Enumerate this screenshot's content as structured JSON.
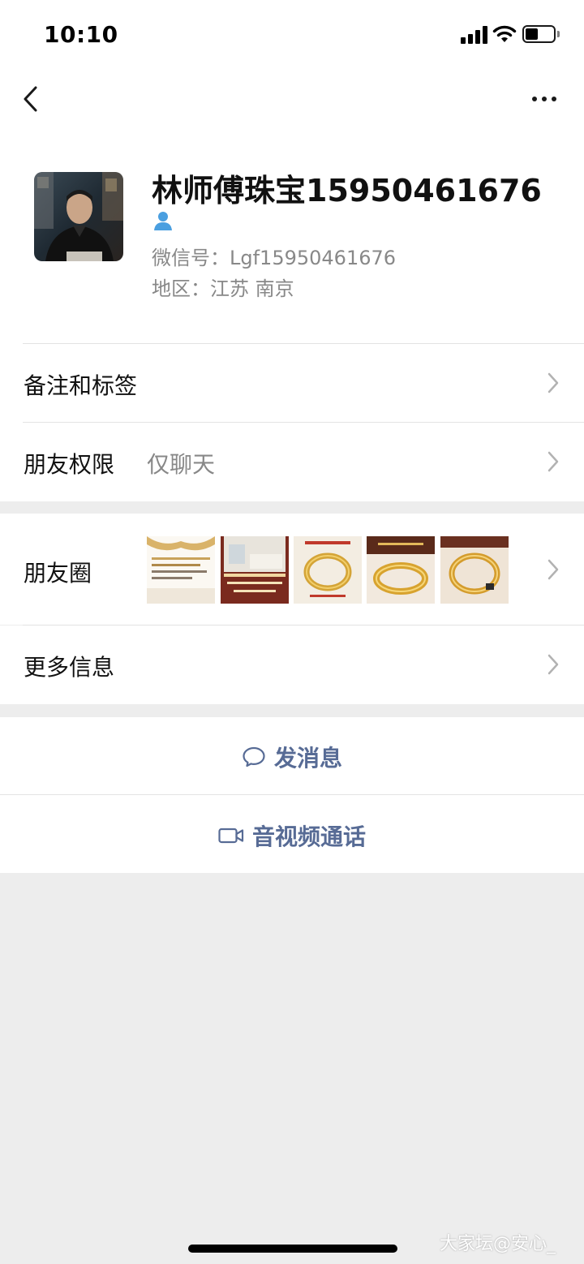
{
  "status_bar": {
    "time": "10:10"
  },
  "profile": {
    "name": "林师傅珠宝15950461676",
    "wechat_id": "微信号：Lgf15950461676",
    "region": "地区：江苏 南京"
  },
  "rows": {
    "remarks_label": "备注和标签",
    "permissions_label": "朋友权限",
    "permissions_value": "仅聊天",
    "moments_label": "朋友圈",
    "more_info_label": "更多信息"
  },
  "actions": {
    "send_message": "发消息",
    "av_call": "音视频通话"
  },
  "watermark": "大家坛@安心_",
  "colors": {
    "link_blue": "#576b95",
    "icon_blue": "#4a9fe0",
    "page_bg": "#ededed"
  },
  "icons": [
    "back-icon",
    "more-dots-icon",
    "person-icon",
    "chevron-right-icon",
    "chat-bubble-icon",
    "video-camera-icon"
  ]
}
